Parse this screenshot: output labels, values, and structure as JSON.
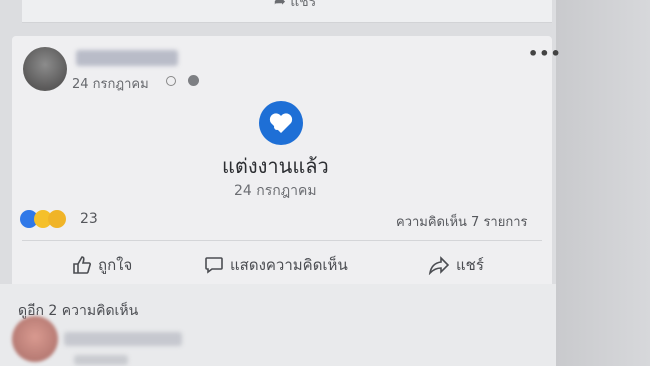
{
  "prev_post": {
    "share_label": "แชร์"
  },
  "post": {
    "date": "24 กรกฎาคม",
    "more_icon": "more-horizontal-icon",
    "event": {
      "icon": "heart-icon",
      "title": "แต่งงานแล้ว",
      "date": "24 กรกฎาคม"
    },
    "reactions": {
      "count": "23",
      "types": [
        "like",
        "haha",
        "wow"
      ]
    },
    "comments_summary": "ความคิดเห็น 7 รายการ",
    "actions": {
      "like": "ถูกใจ",
      "comment": "แสดงความคิดเห็น",
      "share": "แชร์"
    },
    "more_comments": "ดูอีก 2 ความคิดเห็น"
  },
  "colors": {
    "accent": "#1e6fd6"
  }
}
